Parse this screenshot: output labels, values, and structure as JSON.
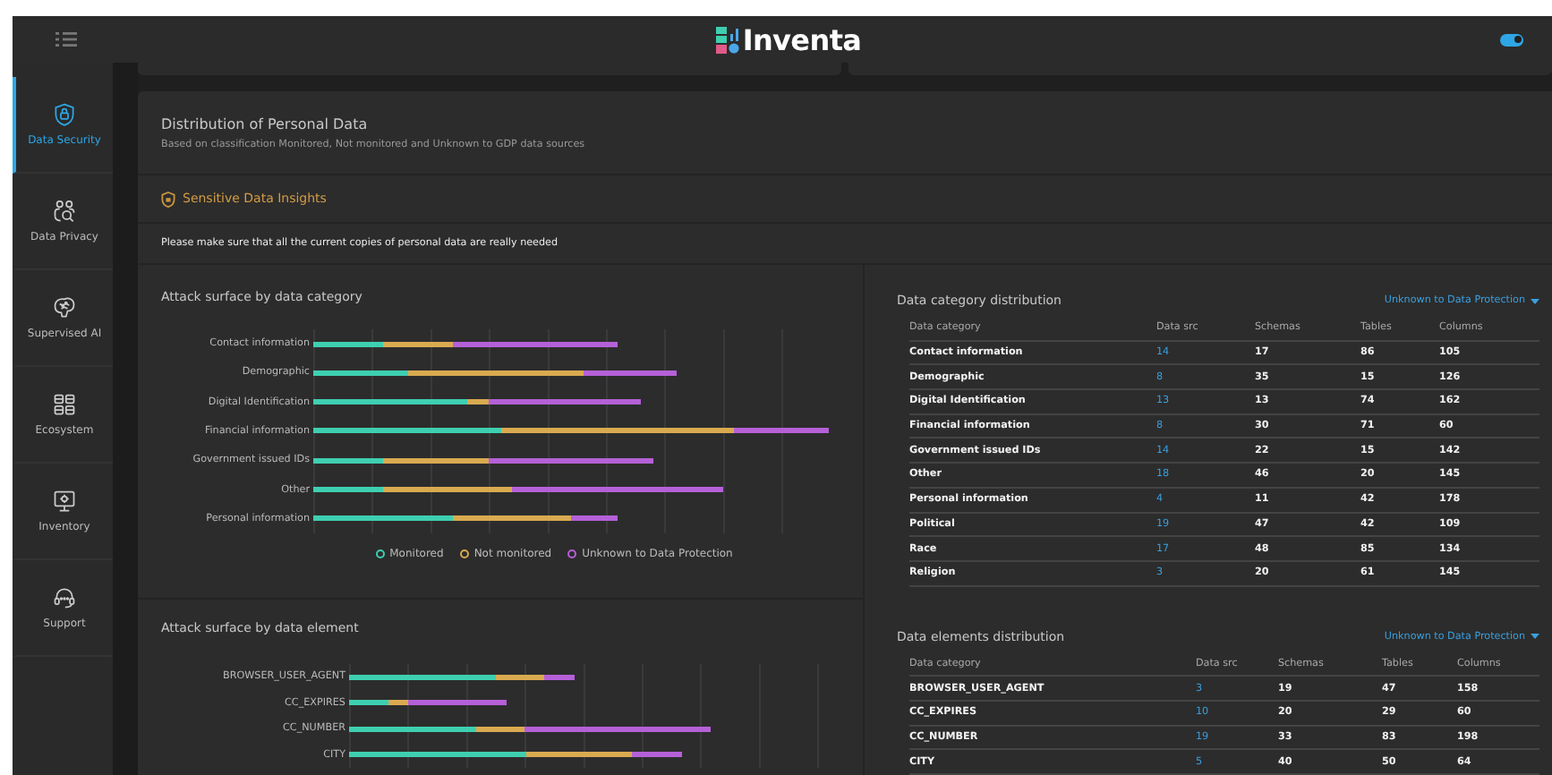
{
  "top_bar": {
    "logo_text": "Inventa",
    "theme_toggle": {
      "on": true
    }
  },
  "sidebar": {
    "items": [
      {
        "label": "Data Security",
        "selected": true
      },
      {
        "label": "Data Privacy",
        "selected": false
      },
      {
        "label": "Supervised AI",
        "selected": false
      },
      {
        "label": "Ecosystem",
        "selected": false
      },
      {
        "label": "Inventory",
        "selected": false
      },
      {
        "label": "Support",
        "selected": false
      }
    ]
  },
  "distribution": {
    "title": "Distribution of Personal Data",
    "subtitle": "Based on classification Monitored, Not monitored and Unknown to GDP data sources"
  },
  "insights": {
    "title": "Sensitive Data Insights",
    "note": "Please make sure that all the current copies of personal data are really needed"
  },
  "category_chart": {
    "title": "Attack surface by data category",
    "labels": [
      "Contact information",
      "Demographic",
      "Digital Identification",
      "Financial information",
      "Government issued IDs",
      "Other",
      "Personal information"
    ],
    "legend": [
      {
        "label": "Monitored",
        "color": "#3ecfb0"
      },
      {
        "label": "Not monitored",
        "color": "#d9aa50"
      },
      {
        "label": "Unknown to Data Protection",
        "color": "#b560d8"
      }
    ]
  },
  "element_chart": {
    "title": "Attack surface by data element",
    "labels": [
      "BROWSER_USER_AGENT",
      "CC_EXPIRES",
      "CC_NUMBER",
      "CITY"
    ]
  },
  "category_table": {
    "title": "Data category distribution",
    "filter": "Unknown to Data Protection",
    "columns": [
      "Data category",
      "Data src",
      "Schemas",
      "Tables",
      "Columns"
    ],
    "rows": [
      [
        "Contact information",
        "14",
        "17",
        "86",
        "105"
      ],
      [
        "Demographic",
        "8",
        "35",
        "15",
        "126"
      ],
      [
        "Digital Identification",
        "13",
        "13",
        "74",
        "162"
      ],
      [
        "Financial information",
        "8",
        "30",
        "71",
        "60"
      ],
      [
        "Government issued IDs",
        "14",
        "22",
        "15",
        "142"
      ],
      [
        "Other",
        "18",
        "46",
        "20",
        "145"
      ],
      [
        "Personal information",
        "4",
        "11",
        "42",
        "178"
      ],
      [
        "Political",
        "19",
        "47",
        "42",
        "109"
      ],
      [
        "Race",
        "17",
        "48",
        "85",
        "134"
      ],
      [
        "Religion",
        "3",
        "20",
        "61",
        "145"
      ]
    ]
  },
  "element_table": {
    "title": "Data elements distribution",
    "filter": "Unknown to Data Protection",
    "columns": [
      "Data category",
      "Data src",
      "Schemas",
      "Tables",
      "Columns"
    ],
    "rows": [
      [
        "BROWSER_USER_AGENT",
        "3",
        "19",
        "47",
        "158"
      ],
      [
        "CC_EXPIRES",
        "10",
        "20",
        "29",
        "60"
      ],
      [
        "CC_NUMBER",
        "19",
        "33",
        "83",
        "198"
      ],
      [
        "CITY",
        "5",
        "40",
        "50",
        "64"
      ]
    ]
  }
}
